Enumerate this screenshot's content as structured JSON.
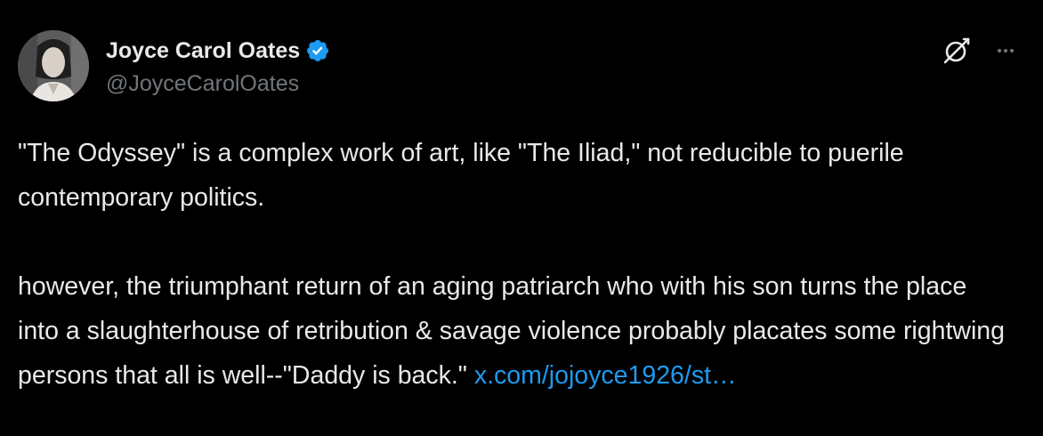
{
  "author": {
    "display_name": "Joyce Carol Oates",
    "handle": "@JoyceCarolOates",
    "verified": true
  },
  "icons": {
    "verified": "verified-badge-icon",
    "grok": "grok-icon",
    "more": "more-options-icon"
  },
  "colors": {
    "background": "#000000",
    "text_primary": "#e7e9ea",
    "text_secondary": "#71767b",
    "link": "#1d9bf0",
    "verified_badge": "#1d9bf0"
  },
  "tweet": {
    "paragraph1": "\"The Odyssey\" is a complex work of art, like \"The Iliad,\" not reducible to puerile contemporary politics.",
    "paragraph2": "however, the triumphant return of an aging patriarch who with his son turns the place into a slaughterhouse of retribution & savage violence probably placates some rightwing persons that all is well--\"Daddy is back.\"",
    "link_text": "x.com/jojoyce1926/st…"
  }
}
